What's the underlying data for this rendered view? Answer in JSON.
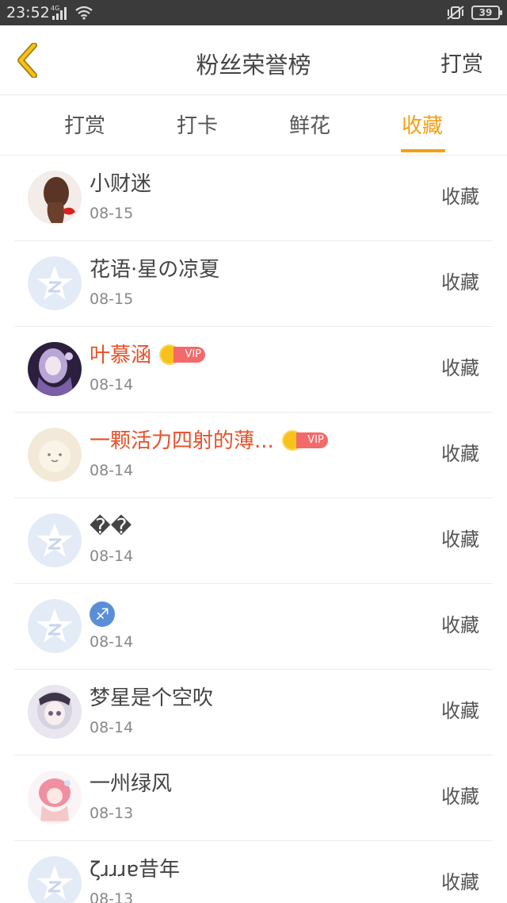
{
  "status_bar": {
    "time": "23:52",
    "signal_label": "4G",
    "battery": "39"
  },
  "header": {
    "title": "粉丝荣誉榜",
    "action_label": "打赏"
  },
  "tabs": [
    {
      "label": "打赏",
      "active": false
    },
    {
      "label": "打卡",
      "active": false
    },
    {
      "label": "鲜花",
      "active": false
    },
    {
      "label": "收藏",
      "active": true
    }
  ],
  "vip_label": "VIP",
  "fans": [
    {
      "name": "小财迷",
      "date": "08-15",
      "action": "收藏",
      "vip": false,
      "avatar": "photo-girl-braid-icon"
    },
    {
      "name": "花语·星の凉夏",
      "date": "08-15",
      "action": "收藏",
      "vip": false,
      "avatar": "default-star-avatar-icon"
    },
    {
      "name": "叶慕涵",
      "date": "08-14",
      "action": "收藏",
      "vip": true,
      "avatar": "anime-girl-purple-icon"
    },
    {
      "name": "一颗活力四射的薄...",
      "date": "08-14",
      "action": "收藏",
      "vip": true,
      "avatar": "plush-toy-cream-icon"
    },
    {
      "name": "��",
      "date": "08-14",
      "action": "收藏",
      "vip": false,
      "avatar": "default-star-avatar-icon"
    },
    {
      "name": "♐",
      "date": "08-14",
      "action": "收藏",
      "vip": false,
      "avatar": "default-star-avatar-icon",
      "zodiac": true
    },
    {
      "name": "梦星是个空吹",
      "date": "08-14",
      "action": "收藏",
      "vip": false,
      "avatar": "anime-girl-white-hair-icon"
    },
    {
      "name": "一州绿风",
      "date": "08-13",
      "action": "收藏",
      "vip": false,
      "avatar": "pink-hair-girl-icon"
    },
    {
      "name": "ζɹɹɹɐ昔年",
      "date": "08-13",
      "action": "收藏",
      "vip": false,
      "avatar": "default-star-avatar-icon"
    }
  ],
  "colors": {
    "accent": "#f5a012",
    "vip_name": "#e8502a",
    "status_bar": "#3b3b3b"
  }
}
